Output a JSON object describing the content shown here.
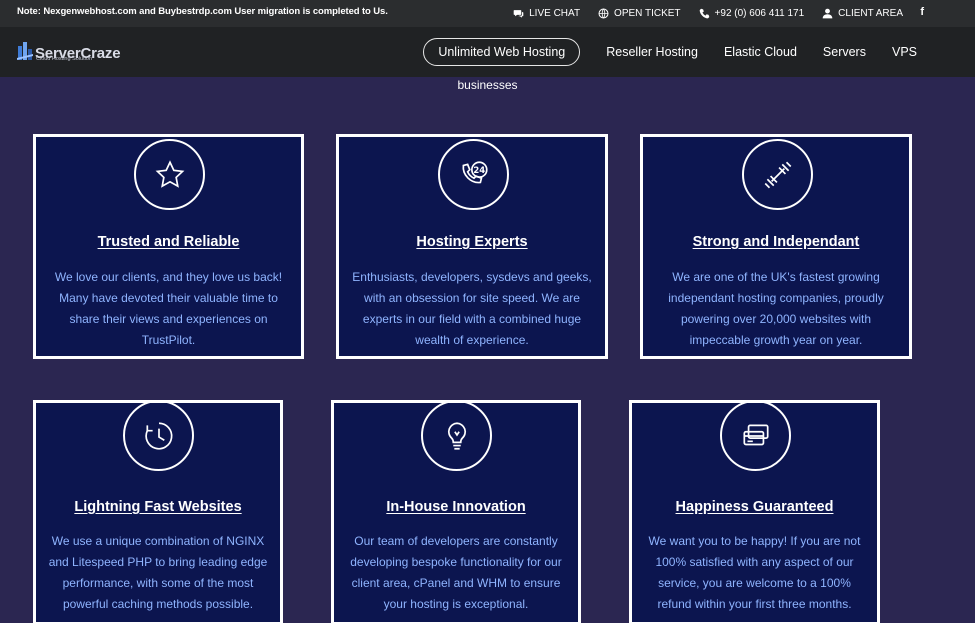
{
  "topbar": {
    "note": "Note: Nexgenwebhost.com and Buybestrdp.com User migration is completed to Us.",
    "live_chat": "LIVE CHAT",
    "open_ticket": "OPEN TICKET",
    "phone": "+92 (0) 606 411 171",
    "client_area": "CLIENT AREA",
    "facebook": "f"
  },
  "navbar": {
    "logo_text": "ServerCraze",
    "logo_sub": "Cloud Hosting Solution",
    "items": [
      "Unlimited Web Hosting",
      "Reseller Hosting",
      "Elastic Cloud",
      "Servers",
      "VPS"
    ]
  },
  "intro_text": "businesses",
  "cards": [
    {
      "icon": "star-icon",
      "title": "Trusted and Reliable",
      "desc": "We love our clients, and they love us back! Many have devoted their valuable time to share their views and experiences on TrustPilot."
    },
    {
      "icon": "support-24-icon",
      "title": "Hosting Experts",
      "desc": "Enthusiasts, developers, sysdevs and geeks, with an obsession for site speed. We are experts in our field with a combined huge wealth of experience."
    },
    {
      "icon": "dumbbell-icon",
      "title": "Strong and Independant",
      "desc": "We are one of the UK's fastest growing independant hosting companies, proudly powering over 20,000 websites with impeccable growth year on year."
    },
    {
      "icon": "clock-icon",
      "title": "Lightning Fast Websites",
      "desc": "We use a unique combination of NGINX and Litespeed PHP to bring leading edge performance, with some of the most powerful caching methods possible."
    },
    {
      "icon": "lightbulb-icon",
      "title": "In-House Innovation",
      "desc": "Our team of developers are constantly developing bespoke functionality for our client area, cPanel and WHM to ensure your hosting is exceptional."
    },
    {
      "icon": "credit-card-icon",
      "title": "Happiness Guaranteed",
      "desc": "We want you to be happy! If you are not 100% satisfied with any aspect of our service, you are welcome to a 100% refund within your first three months."
    }
  ]
}
